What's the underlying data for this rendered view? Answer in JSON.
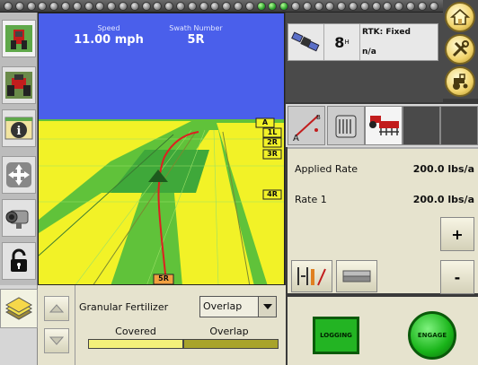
{
  "hud": {
    "speed_label": "Speed",
    "speed_value": "11.00 mph",
    "swath_label": "Swath Number",
    "swath_value": "5R"
  },
  "lane_labels": [
    "A",
    "1L",
    "2R",
    "3R",
    "4R",
    "5R"
  ],
  "gps": {
    "satellites": "8",
    "sat_sup": "H",
    "status": "RTK: Fixed",
    "sub": "n/a"
  },
  "rates": {
    "applied_label": "Applied Rate",
    "applied_value": "200.0 lbs/a",
    "rate1_label": "Rate 1",
    "rate1_value": "200.0 lbs/a",
    "plus_label": "+",
    "minus_label": "-"
  },
  "coverage": {
    "product": "Granular Fertilizer",
    "mode_selected": "Overlap",
    "covered_label": "Covered",
    "overlap_label": "Overlap"
  },
  "controls": {
    "logging_label": "LOGGING",
    "engage_label": "ENGAGE"
  },
  "tabs": {
    "ab_a": "A",
    "ab_b": "B"
  },
  "colors": {
    "sky": "#4a5feb",
    "field_yellow": "#f2f227",
    "field_green": "#60c23a",
    "guide_line": "#dd2020",
    "covered_bar": "#f3f07a",
    "overlap_bar": "#a8a32b"
  }
}
